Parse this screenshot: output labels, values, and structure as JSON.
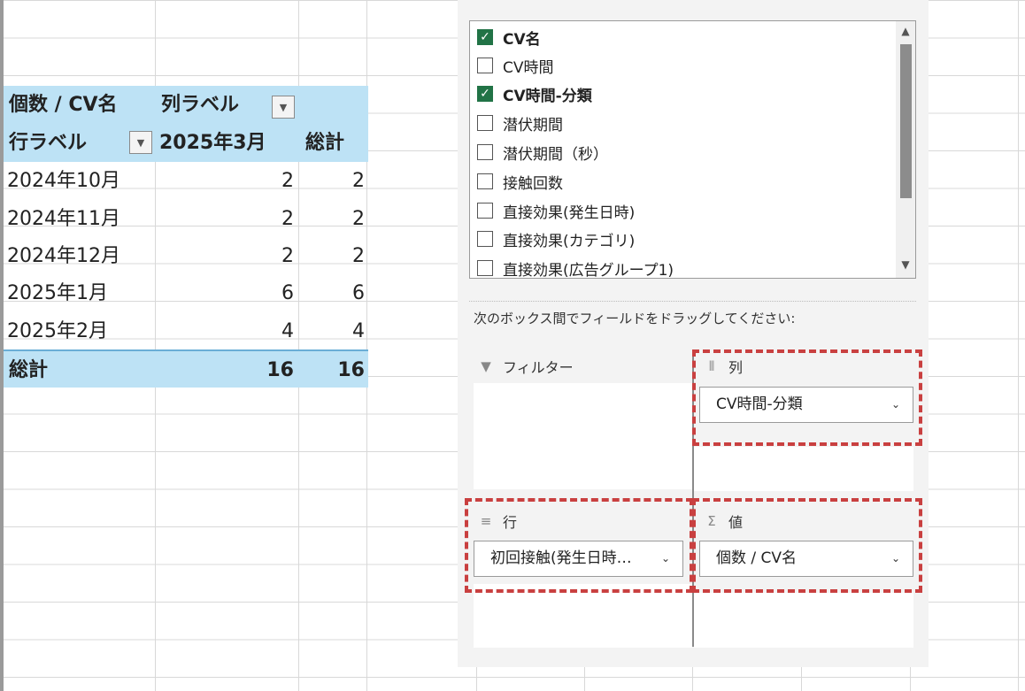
{
  "pivot": {
    "header1": {
      "measure": "個数 / CV名",
      "col_label": "列ラベル"
    },
    "header2": {
      "row_label": "行ラベル",
      "col_value": "2025年3月",
      "total": "総計"
    },
    "rows": [
      {
        "label": "2024年10月",
        "v": "2",
        "t": "2"
      },
      {
        "label": "2024年11月",
        "v": "2",
        "t": "2"
      },
      {
        "label": "2024年12月",
        "v": "2",
        "t": "2"
      },
      {
        "label": "2025年1月",
        "v": "6",
        "t": "6"
      },
      {
        "label": "2025年2月",
        "v": "4",
        "t": "4"
      }
    ],
    "total_row": {
      "label": "総計",
      "v": "16",
      "t": "16"
    }
  },
  "field_list": {
    "items": [
      {
        "label": "CV名",
        "checked": true
      },
      {
        "label": "CV時間",
        "checked": false
      },
      {
        "label": "CV時間-分類",
        "checked": true
      },
      {
        "label": "潜伏期間",
        "checked": false
      },
      {
        "label": "潜伏期間（秒）",
        "checked": false
      },
      {
        "label": "接触回数",
        "checked": false
      },
      {
        "label": "直接効果(発生日時)",
        "checked": false
      },
      {
        "label": "直接効果(カテゴリ)",
        "checked": false
      },
      {
        "label": "直接効果(広告グループ1)",
        "checked": false
      }
    ]
  },
  "areas": {
    "instruction": "次のボックス間でフィールドをドラッグしてください:",
    "filter_title": "フィルター",
    "columns_title": "列",
    "columns_field": "CV時間-分類",
    "rows_title": "行",
    "rows_field": "初回接触(発生日時…",
    "values_title": "値",
    "values_field": "個数 / CV名"
  },
  "colors": {
    "accent_green": "#217346",
    "pivot_header": "#bde2f5",
    "highlight_red": "#c94040"
  }
}
